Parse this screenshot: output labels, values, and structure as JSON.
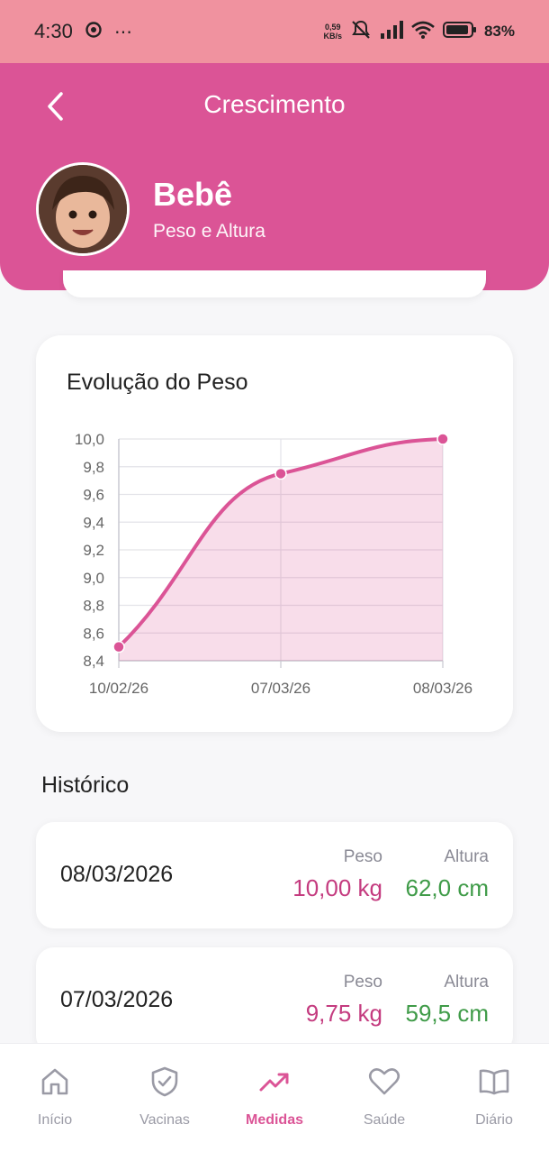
{
  "status_bar": {
    "time": "4:30",
    "net_speed": "0,59",
    "net_unit": "KB/s",
    "battery": "83%"
  },
  "header": {
    "title": "Crescimento",
    "baby_name": "Bebê",
    "subtitle": "Peso e Altura"
  },
  "chart_data": {
    "type": "area",
    "title": "Evolução do Peso",
    "categories": [
      "10/02/26",
      "07/03/26",
      "08/03/26"
    ],
    "values": [
      8.5,
      9.75,
      10.0
    ],
    "ylim": [
      8.4,
      10.0
    ],
    "yticks": [
      "10,0",
      "9,8",
      "9,6",
      "9,4",
      "9,2",
      "9,0",
      "8,8",
      "8,6",
      "8,4"
    ],
    "xlabel": "",
    "ylabel": "",
    "grid": true,
    "color": "#db5496"
  },
  "history": {
    "title": "Histórico",
    "entries": [
      {
        "date": "08/03/2026",
        "peso_label": "Peso",
        "peso": "10,00 kg",
        "altura_label": "Altura",
        "altura": "62,0 cm"
      },
      {
        "date": "07/03/2026",
        "peso_label": "Peso",
        "peso": "9,75 kg",
        "altura_label": "Altura",
        "altura": "59,5 cm"
      }
    ]
  },
  "nav": {
    "items": [
      {
        "label": "Início",
        "icon": "home-icon"
      },
      {
        "label": "Vacinas",
        "icon": "shield-check-icon"
      },
      {
        "label": "Medidas",
        "icon": "trending-up-icon",
        "active": true
      },
      {
        "label": "Saúde",
        "icon": "heart-icon"
      },
      {
        "label": "Diário",
        "icon": "book-icon"
      }
    ]
  },
  "colors": {
    "accent": "#db5496",
    "status_bar": "#f0929f",
    "peso": "#c43b7f",
    "altura": "#3f9b48"
  }
}
